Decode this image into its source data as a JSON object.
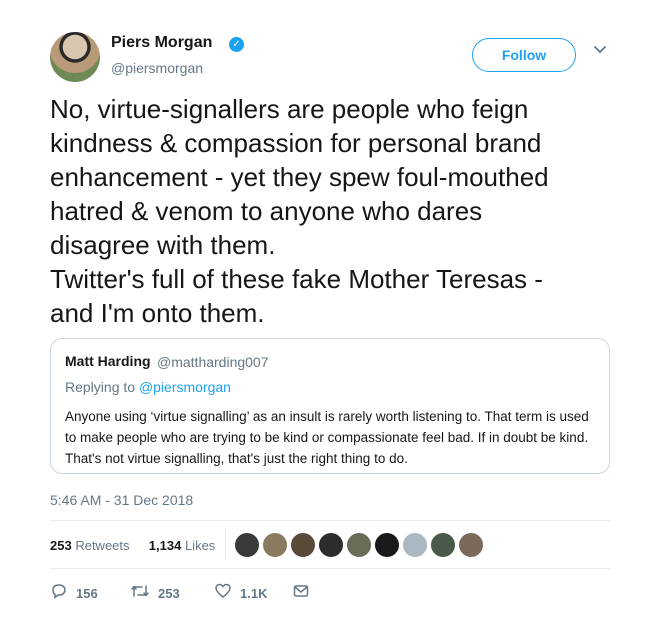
{
  "header": {
    "name": "Piers Morgan",
    "handle": "@piersmorgan",
    "follow_label": "Follow",
    "verified_icon": "✓",
    "caret_icon": "⌄"
  },
  "tweet": {
    "text": "No, virtue-signallers are people who feign\nkindness & compassion for personal brand\nenhancement - yet they spew foul-mouthed\nhatred & venom to anyone who dares\ndisagree with them.\nTwitter's full of these fake Mother Teresas -\nand I'm onto them."
  },
  "quote": {
    "name": "Matt Harding",
    "handle": "@mattharding007",
    "replying_prefix": "Replying to ",
    "replying_handle": "@piersmorgan",
    "text": "Anyone using ‘virtue signalling’ as an insult is rarely worth listening to. That term is used to make people who are trying to be kind or compassionate feel bad. If in doubt be kind. That's not virtue signalling, that's just the right thing to do."
  },
  "timestamp": "5:46 AM - 31 Dec 2018",
  "stats": {
    "retweets_count": "253",
    "retweets_label": "Retweets",
    "likes_count": "1,134",
    "likes_label": "Likes"
  },
  "likers": [
    {
      "color": "#3a3a3a"
    },
    {
      "color": "#8a7a60"
    },
    {
      "color": "#5a4a3a"
    },
    {
      "color": "#2c2c2c"
    },
    {
      "color": "#6b6b5a"
    },
    {
      "color": "#1a1a1a"
    },
    {
      "color": "#aab8c2"
    },
    {
      "color": "#4a5a4a"
    },
    {
      "color": "#7a6a5a"
    }
  ],
  "actions": {
    "reply_icon": "💬",
    "reply_count": "156",
    "retweet_icon": "⇄",
    "retweet_count": "253",
    "like_icon": "♡",
    "like_count": "1.1K",
    "dm_icon": "✉"
  }
}
